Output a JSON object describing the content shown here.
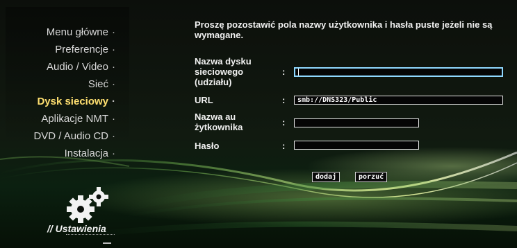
{
  "sidebar": {
    "items": [
      {
        "label": "Menu główne",
        "active": false
      },
      {
        "label": "Preferencje",
        "active": false
      },
      {
        "label": "Audio / Video",
        "active": false
      },
      {
        "label": "Sieć",
        "active": false
      },
      {
        "label": "Dysk sieciowy",
        "active": true
      },
      {
        "label": "Aplikacje NMT",
        "active": false
      },
      {
        "label": "DVD / Audio CD",
        "active": false
      },
      {
        "label": "Instalacja",
        "active": false
      }
    ],
    "bullet": "·",
    "section_title": "// Ustawienia",
    "section_icon": "gears-icon"
  },
  "form": {
    "notice": "Proszę pozostawić pola nazwy użytkownika i hasła puste jeżeli nie są wymagane.",
    "share_label": "Nazwa dysku sieciowego (udziału)",
    "url_label": "URL",
    "user_label": "Nazwa au żytkownika",
    "password_label": "Hasło",
    "colon": ":",
    "share_value": "",
    "url_value": "smb://DNS323/Public",
    "user_value": "",
    "password_value": ""
  },
  "buttons": {
    "add": "dodaj",
    "cancel": "porzuć"
  },
  "colors": {
    "active_menu": "#ffe070",
    "focus_border": "#8fd8ff"
  }
}
